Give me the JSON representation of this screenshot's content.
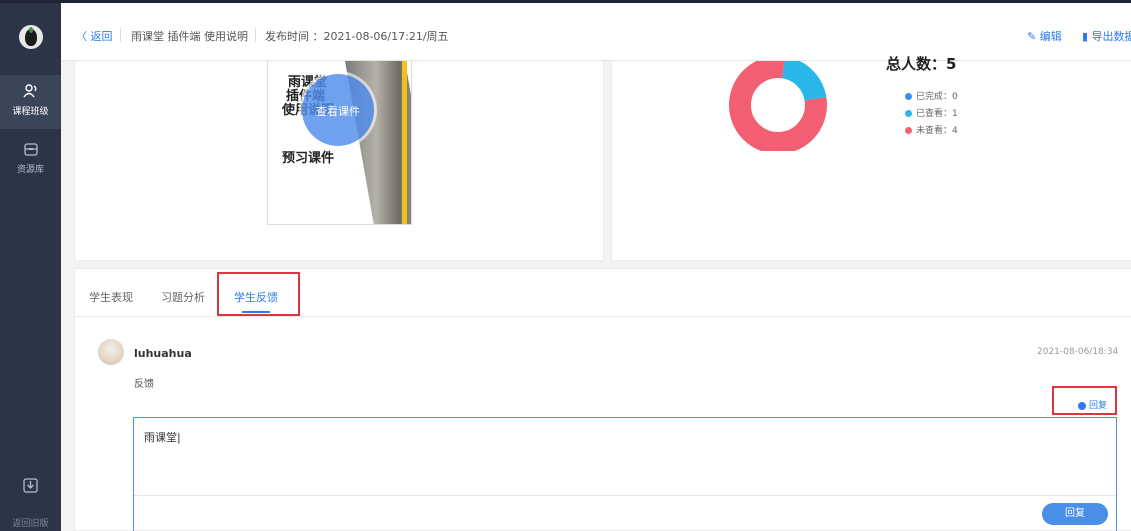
{
  "sidebar": {
    "items": [
      {
        "label": "课程班级"
      },
      {
        "label": "资源库"
      }
    ],
    "bottom_label": "返回旧版"
  },
  "header": {
    "back": "〈 返回",
    "title": "雨课堂 插件端 使用说明",
    "publish_time": "发布时间 ：2021-08-06/17:21/周五",
    "edit": "编辑",
    "export": "导出数据"
  },
  "courseware": {
    "cover_lines": [
      "雨课堂",
      "插件端",
      "使用说明"
    ],
    "cover_sub": "预习课件",
    "view_label": "查看课件"
  },
  "stats": {
    "total": "总人数：5",
    "legend": [
      {
        "label": "已完成：0",
        "value": 0,
        "color": "#3a8ee6"
      },
      {
        "label": "已查看：1",
        "value": 1,
        "color": "#29b6e8"
      },
      {
        "label": "未查看：4",
        "value": 4,
        "color": "#f25f73"
      }
    ]
  },
  "tabs": [
    {
      "label": "学生表现"
    },
    {
      "label": "习题分析"
    },
    {
      "label": "学生反馈"
    }
  ],
  "feedback": {
    "user": "luhuahua",
    "time": "2021-08-06/18:34",
    "text": "反馈",
    "reply_link": "回复",
    "reply_input": "雨课堂|",
    "reply_button": "回复"
  },
  "colors": {
    "accent": "#2b7ce9",
    "sidebar": "#2c3547",
    "highlight": "#d9363e"
  }
}
